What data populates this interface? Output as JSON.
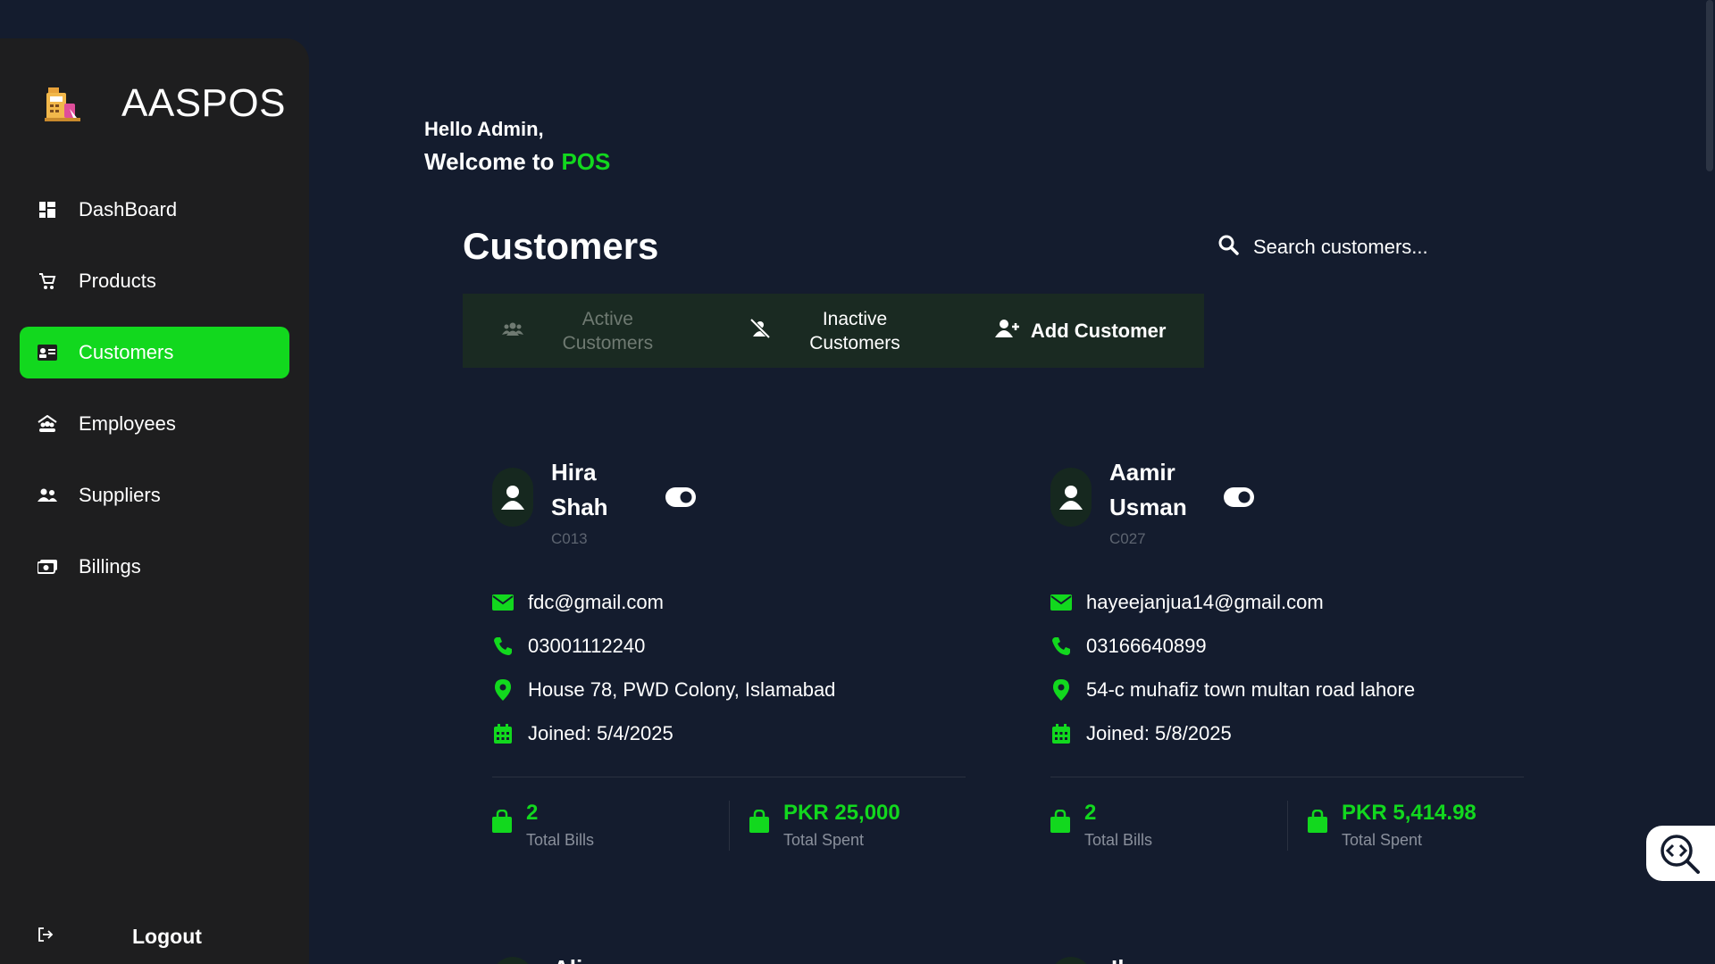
{
  "app": {
    "name": "AASPOS",
    "logo_icon": "cash-register-icon"
  },
  "sidebar": {
    "items": [
      {
        "label": "DashBoard",
        "icon": "dashboard-icon",
        "active": false
      },
      {
        "label": "Products",
        "icon": "cart-icon",
        "active": false
      },
      {
        "label": "Customers",
        "icon": "id-card-icon",
        "active": true
      },
      {
        "label": "Employees",
        "icon": "employees-icon",
        "active": false
      },
      {
        "label": "Suppliers",
        "icon": "users-icon",
        "active": false
      },
      {
        "label": "Billings",
        "icon": "money-icon",
        "active": false
      }
    ],
    "logout_label": "Logout"
  },
  "greeting": {
    "hello": "Hello Admin,",
    "welcome": "Welcome to",
    "highlight": "POS"
  },
  "page": {
    "title": "Customers"
  },
  "search": {
    "placeholder": "Search customers..."
  },
  "tabs": [
    {
      "label": "Active Customers",
      "icon": "users-group-icon"
    },
    {
      "label": "Inactive Customers",
      "icon": "user-slash-icon"
    },
    {
      "label": "Add Customer",
      "icon": "user-plus-icon"
    }
  ],
  "customers": [
    {
      "name": "Hira Shah",
      "id": "C013",
      "email": "fdc@gmail.com",
      "phone": "03001112240",
      "address": "House 78, PWD Colony, Islamabad",
      "joined": "Joined: 5/4/2025",
      "total_bills": "2",
      "total_bills_label": "Total Bills",
      "total_spent": "PKR 25,000",
      "total_spent_label": "Total Spent",
      "active": true
    },
    {
      "name": "Aamir Usman",
      "id": "C027",
      "email": "hayeejanjua14@gmail.com",
      "phone": "03166640899",
      "address": "54-c muhafiz town multan road lahore",
      "joined": "Joined: 5/8/2025",
      "total_bills": "2",
      "total_bills_label": "Total Bills",
      "total_spent": "PKR 5,414.98",
      "total_spent_label": "Total Spent",
      "active": true
    },
    {
      "name": "Alia"
    },
    {
      "name": "Ihr"
    }
  ],
  "colors": {
    "accent": "#12d81e",
    "background": "#141c2e",
    "sidebar": "#1e1e1f"
  }
}
